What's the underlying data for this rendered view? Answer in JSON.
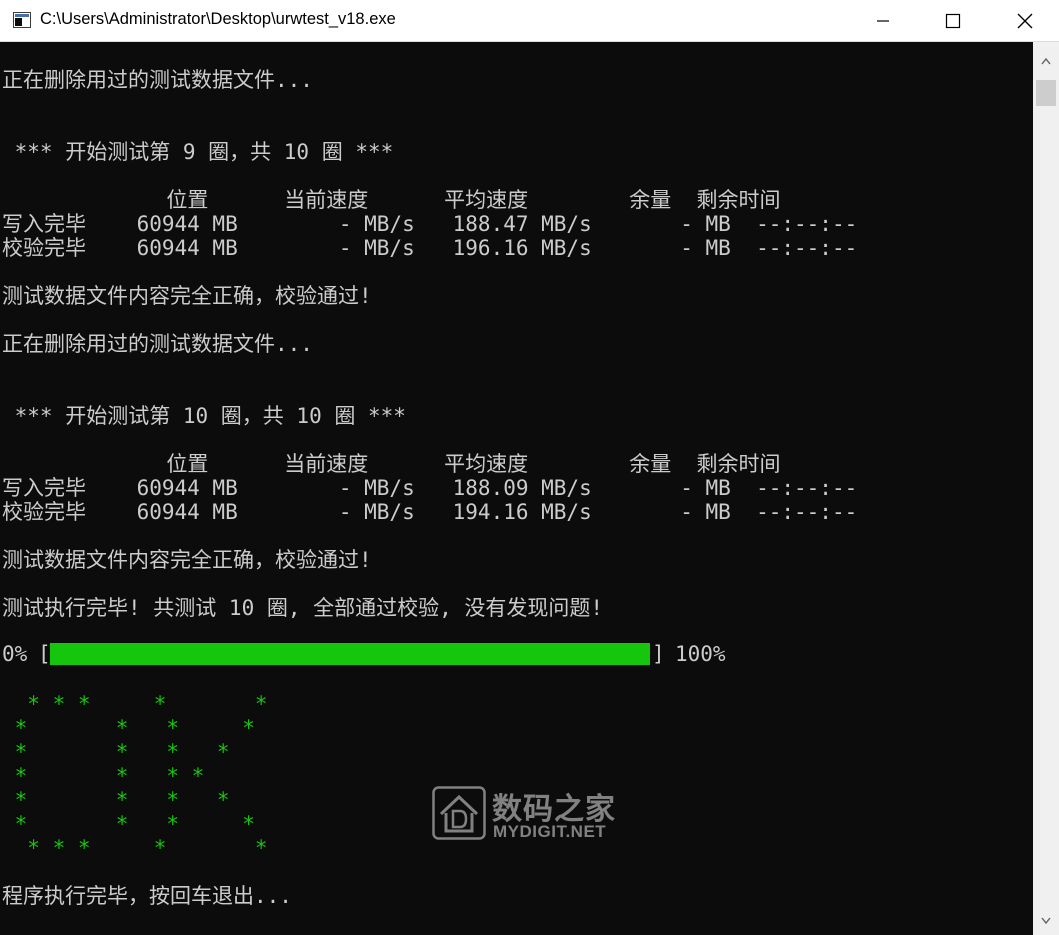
{
  "window": {
    "title": "C:\\Users\\Administrator\\Desktop\\urwtest_v18.exe",
    "icon": "console-app-icon",
    "controls": [
      "minimize-icon",
      "maximize-icon",
      "close-icon"
    ]
  },
  "console": {
    "lines": [
      "正在删除用过的测试数据文件...",
      " *** 开始测试第 9 圈，共 10 圈 ***",
      "             位置      当前速度      平均速度        余量  剩余时间",
      "写入完毕    60944 MB        - MB/s   188.47 MB/s       - MB  --:--:--",
      "校验完毕    60944 MB        - MB/s   196.16 MB/s       - MB  --:--:--",
      "测试数据文件内容完全正确，校验通过!",
      "正在删除用过的测试数据文件...",
      " *** 开始测试第 10 圈，共 10 圈 ***",
      "             位置      当前速度      平均速度        余量  剩余时间",
      "写入完毕    60944 MB        - MB/s   188.09 MB/s       - MB  --:--:--",
      "校验完毕    60944 MB        - MB/s   194.16 MB/s       - MB  --:--:--",
      "测试数据文件内容完全正确，校验通过!",
      "测试执行完毕! 共测试 10 圈, 全部通过校验, 没有发现问题!"
    ],
    "progress": {
      "start_label": "0%",
      "left_bracket": "[",
      "right_bracket": "]",
      "end_label": "100%",
      "percent": 100,
      "fill_color": "#16c60c"
    },
    "ok_art": [
      "  * * *     *       *",
      " *       *   *     *",
      " *       *   *   *",
      " *       *   * *",
      " *       *   *   *",
      " *       *   *     *",
      "  * * *     *       *"
    ],
    "ok_art_color": "#16c60c",
    "exit_line": "程序执行完毕，按回车退出..."
  },
  "watermark": {
    "cn": "数码之家",
    "en": "MYDIGIT.NET",
    "logo": "mydigit-logo-icon"
  },
  "scrollbar": {
    "up": "scroll-up-arrow-icon",
    "down": "scroll-down-arrow-icon"
  }
}
